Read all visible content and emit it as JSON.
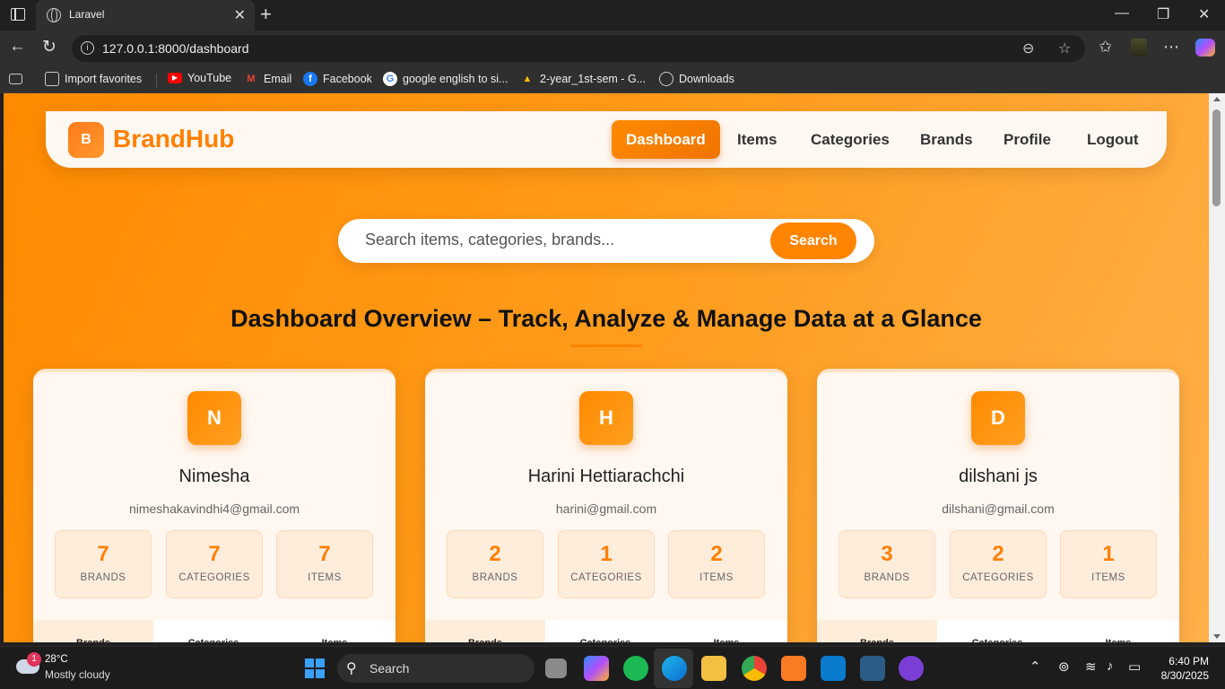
{
  "browser": {
    "tab_title": "Laravel",
    "url": "127.0.0.1:8000/dashboard",
    "bookmarks": [
      {
        "label": "Import favorites",
        "icon": "import-icon"
      },
      {
        "label": "YouTube",
        "icon": "youtube-icon"
      },
      {
        "label": "Email",
        "icon": "gmail-icon"
      },
      {
        "label": "Facebook",
        "icon": "facebook-icon"
      },
      {
        "label": "google english to si...",
        "icon": "google-icon"
      },
      {
        "label": "2-year_1st-sem - G...",
        "icon": "drive-icon"
      },
      {
        "label": "Downloads",
        "icon": "globe-icon"
      }
    ]
  },
  "navbar": {
    "logo_letter": "B",
    "brand": "BrandHub",
    "links": [
      "Dashboard",
      "Items",
      "Categories",
      "Brands",
      "Profile",
      "Logout"
    ],
    "active": "Dashboard"
  },
  "search": {
    "placeholder": "Search items, categories, brands...",
    "button": "Search"
  },
  "heading": "Dashboard Overview – Track, Analyze & Manage Data at a Glance",
  "stat_labels": {
    "brands": "BRANDS",
    "categories": "CATEGORIES",
    "items": "ITEMS"
  },
  "tab_labels": [
    "Brands",
    "Categories",
    "Items"
  ],
  "users": [
    {
      "initial": "N",
      "name": "Nimesha",
      "email": "nimeshakavindhi4@gmail.com",
      "brands": "7",
      "categories": "7",
      "items": "7"
    },
    {
      "initial": "H",
      "name": "Harini Hettiarachchi",
      "email": "harini@gmail.com",
      "brands": "2",
      "categories": "1",
      "items": "2"
    },
    {
      "initial": "D",
      "name": "dilshani js",
      "email": "dilshani@gmail.com",
      "brands": "3",
      "categories": "2",
      "items": "1"
    }
  ],
  "taskbar": {
    "weather_badge": "1",
    "temperature": "28°C",
    "weather_desc": "Mostly cloudy",
    "search_label": "Search",
    "time": "6:40 PM",
    "date": "8/30/2025"
  },
  "colors": {
    "accent": "#ff8400",
    "page_bg": "#ff9a18",
    "card_bg": "#fff7f0"
  }
}
